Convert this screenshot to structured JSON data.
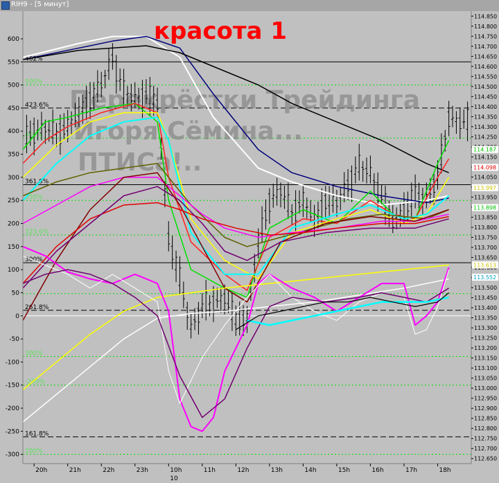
{
  "window": {
    "title": "RIH9 - [5 минут]"
  },
  "chart_data": {
    "type": "line",
    "title": "красота 1",
    "watermark": [
      "Перекрёстки Трейдинга",
      "Игоря Сёмина...",
      "ПТИСа!.."
    ],
    "background": "#c0c0c0",
    "x_ticks": [
      {
        "t": 1,
        "label": "20h"
      },
      {
        "t": 4,
        "label": "21h"
      },
      {
        "t": 7,
        "label": "22h"
      },
      {
        "t": 10,
        "label": "23h"
      },
      {
        "t": 13,
        "label": "10h"
      },
      {
        "t": 16,
        "label": "11h"
      },
      {
        "t": 19,
        "label": "12h"
      },
      {
        "t": 22,
        "label": "13h"
      },
      {
        "t": 25,
        "label": "14h"
      },
      {
        "t": 28,
        "label": "15h"
      },
      {
        "t": 31,
        "label": "16h"
      },
      {
        "t": 34,
        "label": "17h"
      },
      {
        "t": 37,
        "label": "18h"
      }
    ],
    "x_sublabel": {
      "t": 13,
      "label": "10"
    },
    "xlim": [
      0,
      40
    ],
    "left_axis": {
      "ticks": [
        600,
        550,
        500,
        450,
        400,
        350,
        300,
        250,
        200,
        150,
        100,
        50,
        0,
        -50,
        -100,
        -150,
        -200,
        -250,
        -300
      ],
      "ylim": [
        -320,
        660
      ]
    },
    "right_axis": {
      "ticks": [
        "114.850",
        "114.800",
        "114.750",
        "114.700",
        "114.650",
        "114.600",
        "114.550",
        "114.500",
        "114.450",
        "114.400",
        "114.350",
        "114.300",
        "114.250",
        "114.200",
        "114.150",
        "114.100",
        "114.050",
        "114.000",
        "113.950",
        "113.900",
        "113.850",
        "113.800",
        "113.750",
        "113.700",
        "113.650",
        "113.600",
        "113.550",
        "113.500",
        "113.450",
        "113.400",
        "113.350",
        "113.300",
        "113.250",
        "113.200",
        "113.150",
        "113.100",
        "113.050",
        "113.000",
        "112.950",
        "112.900",
        "112.850",
        "112.800",
        "112.750",
        "112.700",
        "112.650"
      ],
      "ylim": [
        112.625,
        114.875
      ],
      "badges": [
        {
          "value": 114.187,
          "label": "114.187",
          "color": "#00c000"
        },
        {
          "value": 114.098,
          "label": "114.098",
          "color": "#e00000"
        },
        {
          "value": 113.997,
          "label": "113.997",
          "color": "#d0c000"
        },
        {
          "value": 113.898,
          "label": "113.898",
          "color": "#00c000"
        },
        {
          "value": 113.613,
          "label": "113.613",
          "color": "#d0c000"
        },
        {
          "value": 113.552,
          "label": "113.552",
          "color": "#00a0c0"
        }
      ]
    },
    "levels": [
      {
        "y": 550,
        "label": "462%",
        "style": "solid",
        "color": "#000000"
      },
      {
        "y": 500,
        "label": "500%",
        "style": "dotted",
        "color": "#00e000"
      },
      {
        "y": 450,
        "label": "423.6%",
        "style": "dashed",
        "color": "#000000"
      },
      {
        "y": 385,
        "label": "400%",
        "style": "dotted",
        "color": "#00e000"
      },
      {
        "y": 284,
        "label": "361.8%",
        "style": "solid",
        "color": "#000000"
      },
      {
        "y": 250,
        "label": "350%",
        "style": "dotted",
        "color": "#00e000"
      },
      {
        "y": 175,
        "label": "323.6%",
        "style": "dotted",
        "color": "#00e000"
      },
      {
        "y": 115,
        "label": "300%",
        "style": "solid",
        "color": "#000000"
      },
      {
        "y": 48,
        "label": "",
        "style": "dotted",
        "color": "#00e000"
      },
      {
        "y": 12,
        "label": "261.8%",
        "style": "dashed",
        "color": "#000000"
      },
      {
        "y": 0,
        "label": "",
        "style": "solid",
        "color": "#ffffff"
      },
      {
        "y": -88,
        "label": "300%",
        "style": "dotted",
        "color": "#00e000"
      },
      {
        "y": -150,
        "label": "-200%",
        "style": "dotted",
        "color": "#00e000"
      },
      {
        "y": -262,
        "label": "161.8%",
        "style": "dashed",
        "color": "#000000"
      },
      {
        "y": -300,
        "label": "200%",
        "style": "dotted",
        "color": "#00e000"
      }
    ],
    "price_bars": {
      "color": "#000000",
      "close": [
        380,
        400,
        405,
        395,
        410,
        440,
        470,
        500,
        560,
        485,
        470,
        480,
        460,
        170,
        80,
        -25,
        20,
        30,
        40,
        -10,
        -5,
        160,
        250,
        270,
        225,
        250,
        205,
        250,
        245,
        285,
        325,
        310,
        255,
        205,
        230,
        260,
        255,
        300,
        430,
        420
      ]
    },
    "series": [
      {
        "color": "#ffffff",
        "width": 2,
        "x": [
          0,
          5,
          8,
          11,
          14,
          17,
          21,
          24,
          28,
          32,
          36,
          38
        ],
        "values": [
          560,
          590,
          605,
          605,
          560,
          430,
          320,
          290,
          260,
          240,
          250,
          260
        ]
      },
      {
        "color": "#00007a",
        "width": 1.5,
        "x": [
          0,
          5,
          8,
          11,
          14,
          17,
          21,
          24,
          28,
          32,
          36,
          38
        ],
        "values": [
          555,
          580,
          595,
          605,
          580,
          480,
          360,
          310,
          280,
          260,
          245,
          255
        ]
      },
      {
        "color": "#000000",
        "width": 1.5,
        "x": [
          0,
          5,
          8,
          11,
          14,
          17,
          21,
          24,
          28,
          32,
          36,
          38
        ],
        "values": [
          555,
          575,
          580,
          585,
          570,
          540,
          500,
          460,
          420,
          380,
          330,
          310
        ]
      },
      {
        "color": "#00e000",
        "width": 1.5,
        "x": [
          0,
          2,
          4,
          7,
          10,
          12,
          13,
          15,
          18,
          20,
          22,
          25,
          28,
          31,
          33,
          35,
          37,
          38
        ],
        "values": [
          360,
          420,
          430,
          450,
          460,
          420,
          250,
          100,
          60,
          40,
          190,
          230,
          200,
          270,
          220,
          210,
          330,
          380
        ]
      },
      {
        "color": "#ff2020",
        "width": 1.5,
        "x": [
          0,
          2,
          4,
          7,
          10,
          12,
          13,
          15,
          18,
          20,
          22,
          25,
          28,
          31,
          33,
          35,
          37,
          38
        ],
        "values": [
          330,
          380,
          410,
          440,
          460,
          440,
          300,
          160,
          90,
          55,
          170,
          210,
          200,
          250,
          220,
          210,
          300,
          340
        ]
      },
      {
        "color": "#ffff00",
        "width": 1.5,
        "x": [
          0,
          3,
          6,
          9,
          12,
          13,
          15,
          18,
          21,
          24,
          28,
          31,
          34,
          36,
          38
        ],
        "values": [
          300,
          370,
          420,
          440,
          440,
          380,
          210,
          120,
          80,
          180,
          210,
          230,
          200,
          220,
          300
        ]
      },
      {
        "color": "#00ffff",
        "width": 2,
        "x": [
          0,
          3,
          6,
          9,
          12,
          13,
          15,
          18,
          21,
          24,
          28,
          31,
          34,
          36,
          38
        ],
        "values": [
          250,
          330,
          390,
          420,
          430,
          380,
          180,
          90,
          90,
          190,
          220,
          240,
          210,
          220,
          260
        ]
      },
      {
        "color": "#606000",
        "width": 1.5,
        "x": [
          0,
          3,
          6,
          9,
          12,
          13,
          15,
          18,
          20,
          23,
          26,
          29,
          32,
          36,
          38
        ],
        "values": [
          260,
          290,
          310,
          320,
          330,
          300,
          240,
          170,
          150,
          170,
          190,
          210,
          220,
          210,
          230
        ]
      },
      {
        "color": "#ff00ff",
        "width": 1.5,
        "x": [
          0,
          3,
          6,
          9,
          12,
          14,
          16,
          18,
          21,
          24,
          28,
          32,
          35,
          38
        ],
        "values": [
          200,
          240,
          280,
          300,
          300,
          260,
          220,
          190,
          170,
          180,
          190,
          205,
          205,
          220
        ]
      },
      {
        "color": "#800000",
        "width": 1.5,
        "x": [
          0,
          3,
          6,
          9,
          12,
          14,
          16,
          18,
          20,
          23,
          27,
          31,
          35,
          38
        ],
        "values": [
          -10,
          120,
          230,
          300,
          310,
          240,
          150,
          60,
          30,
          160,
          200,
          215,
          205,
          230
        ]
      },
      {
        "color": "#e00000",
        "width": 1.5,
        "x": [
          0,
          3,
          6,
          9,
          12,
          14,
          16,
          19,
          22,
          25,
          28,
          32,
          35,
          38
        ],
        "values": [
          70,
          150,
          210,
          240,
          245,
          230,
          210,
          190,
          175,
          180,
          190,
          200,
          200,
          215
        ]
      },
      {
        "color": "#700070",
        "width": 1.5,
        "x": [
          0,
          3,
          6,
          9,
          12,
          14,
          16,
          18,
          20,
          23,
          27,
          31,
          35,
          38
        ],
        "values": [
          60,
          140,
          200,
          260,
          280,
          250,
          200,
          140,
          120,
          160,
          180,
          190,
          190,
          210
        ]
      },
      {
        "color": "#ffff00",
        "width": 1.5,
        "x": [
          0,
          3,
          6,
          9,
          12,
          15,
          18,
          22,
          26,
          30,
          34,
          38
        ],
        "values": [
          -160,
          -100,
          -40,
          10,
          40,
          50,
          60,
          70,
          80,
          90,
          100,
          110
        ]
      },
      {
        "color": "#ffffff",
        "width": 1.5,
        "x": [
          0,
          3,
          6,
          9,
          12,
          15,
          18,
          22,
          26,
          30,
          34,
          38
        ],
        "values": [
          -230,
          -170,
          -110,
          -50,
          -5,
          5,
          10,
          20,
          30,
          45,
          60,
          80
        ]
      },
      {
        "color": "#ff00ff",
        "width": 2,
        "x": [
          0,
          2,
          4,
          6,
          8,
          10,
          12,
          13,
          14,
          15,
          16,
          17,
          18,
          20,
          21,
          22,
          24,
          26,
          28,
          30,
          32,
          34,
          35,
          36,
          37,
          38
        ],
        "values": [
          150,
          130,
          95,
          80,
          70,
          90,
          70,
          10,
          -180,
          -240,
          -250,
          -220,
          -120,
          -20,
          70,
          90,
          60,
          40,
          10,
          40,
          70,
          70,
          -20,
          0,
          30,
          105
        ]
      },
      {
        "color": "#ffffff",
        "width": 1,
        "x": [
          0,
          2,
          4,
          6,
          8,
          10,
          12,
          13,
          14,
          15,
          16,
          18,
          20,
          22,
          24,
          26,
          28,
          30,
          32,
          34,
          35,
          36,
          37,
          38
        ],
        "values": [
          130,
          110,
          90,
          60,
          90,
          60,
          30,
          -120,
          -190,
          -140,
          -90,
          -20,
          40,
          90,
          40,
          10,
          -10,
          30,
          50,
          40,
          -40,
          -30,
          20,
          100
        ]
      },
      {
        "color": "#700070",
        "width": 1.5,
        "x": [
          0,
          2,
          4,
          6,
          8,
          10,
          12,
          14,
          16,
          18,
          20,
          22,
          24,
          27,
          30,
          32,
          34,
          36,
          38
        ],
        "values": [
          70,
          90,
          100,
          90,
          70,
          40,
          0,
          -130,
          -220,
          -180,
          -70,
          20,
          40,
          30,
          40,
          50,
          40,
          30,
          60
        ]
      },
      {
        "color": "#00ffff",
        "width": 2.5,
        "x": [
          20,
          22,
          24,
          26,
          28,
          30,
          32,
          34,
          36,
          38
        ],
        "values": [
          -10,
          -20,
          -10,
          0,
          10,
          20,
          30,
          30,
          30,
          40
        ]
      },
      {
        "color": "#000000",
        "width": 1.2,
        "x": [
          19,
          21,
          23,
          25,
          27,
          29,
          31,
          33,
          35,
          37,
          38
        ],
        "values": [
          -30,
          0,
          10,
          20,
          30,
          30,
          40,
          30,
          20,
          30,
          50
        ]
      }
    ]
  }
}
